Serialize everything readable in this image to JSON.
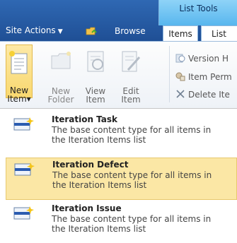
{
  "header": {
    "contextual_group": "List Tools",
    "site_actions_label": "Site Actions",
    "browse_label": "Browse",
    "tabs": [
      {
        "label": "Items"
      },
      {
        "label": "List"
      }
    ]
  },
  "ribbon": {
    "new_item": {
      "label_line1": "New",
      "label_line2": "Item",
      "caret": "▾"
    },
    "new_folder": {
      "label_line1": "New",
      "label_line2": "Folder"
    },
    "view_item": {
      "label_line1": "View",
      "label_line2": "Item"
    },
    "edit_item": {
      "label_line1": "Edit",
      "label_line2": "Item"
    },
    "small_commands": [
      {
        "label": "Version H",
        "icon": "version-history-icon"
      },
      {
        "label": "Item Perm",
        "icon": "item-permissions-icon"
      },
      {
        "label": "Delete Ite",
        "icon": "delete-icon"
      }
    ]
  },
  "menu": {
    "items": [
      {
        "title": "Iteration Task",
        "desc_line1": "The base content type for all items in",
        "desc_line2": "the Iteration Items list",
        "highlighted": false
      },
      {
        "title": "Iteration Defect",
        "desc_line1": "The base content type for all items in",
        "desc_line2": "the Iteration Items list",
        "highlighted": true
      },
      {
        "title": "Iteration Issue",
        "desc_line1": "The base content type for all items in",
        "desc_line2": "the Iteration Items list",
        "highlighted": false
      }
    ]
  },
  "colors": {
    "header_blue": "#1f4f95",
    "contextual_cyan": "#58b6ee",
    "highlight": "#fbe7a5"
  }
}
